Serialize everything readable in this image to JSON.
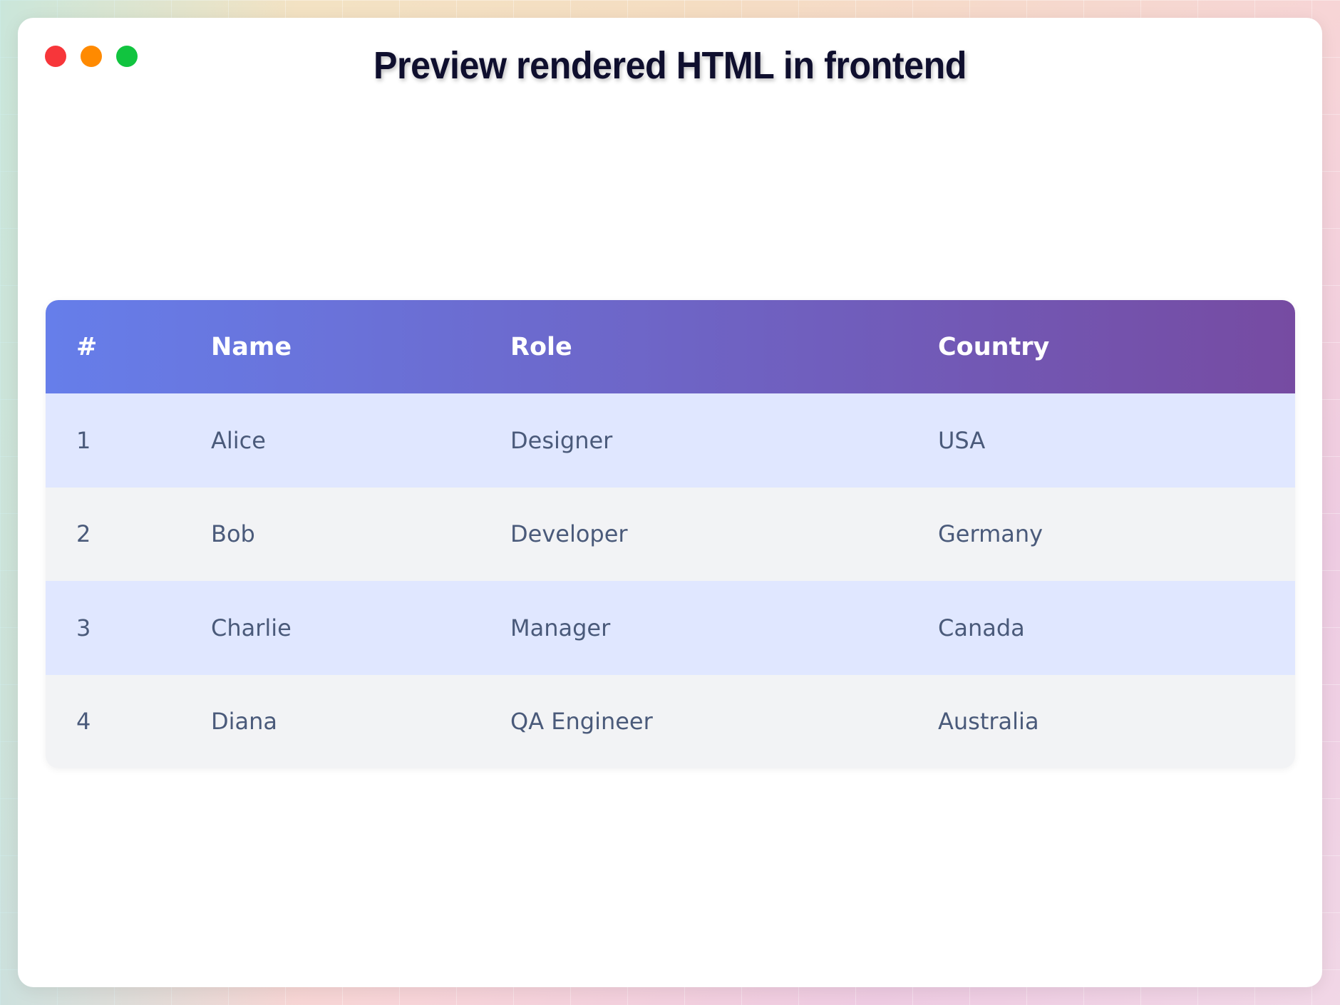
{
  "window": {
    "title": "Preview rendered HTML in frontend",
    "controls": [
      "close",
      "minimize",
      "maximize"
    ]
  },
  "table": {
    "headers": [
      "#",
      "Name",
      "Role",
      "Country"
    ],
    "rows": [
      {
        "num": "1",
        "name": "Alice",
        "role": "Designer",
        "country": "USA"
      },
      {
        "num": "2",
        "name": "Bob",
        "role": "Developer",
        "country": "Germany"
      },
      {
        "num": "3",
        "name": "Charlie",
        "role": "Manager",
        "country": "Canada"
      },
      {
        "num": "4",
        "name": "Diana",
        "role": "QA Engineer",
        "country": "Australia"
      }
    ]
  },
  "colors": {
    "header_gradient_start": "#667eea",
    "header_gradient_end": "#764ba2",
    "row_odd": "#e0e7ff",
    "row_even": "#f2f3f5",
    "close": "#f7363a",
    "minimize": "#ff8a00",
    "maximize": "#11c43f"
  }
}
